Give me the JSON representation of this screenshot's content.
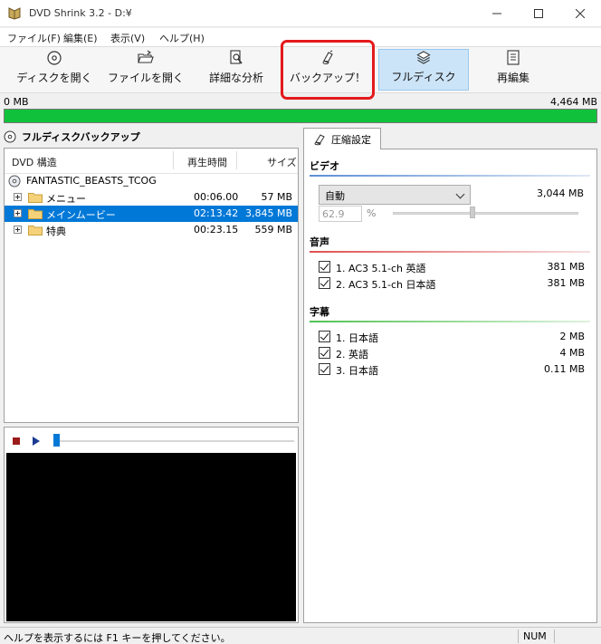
{
  "window": {
    "title": "DVD Shrink 3.2 - D:¥"
  },
  "menu": {
    "items": [
      "ファイル(F)",
      "編集(E)",
      "表示(V)",
      "ヘルプ(H)"
    ]
  },
  "toolbar": {
    "open_disc": "ディスクを開く",
    "open_files": "ファイルを開く",
    "analysis": "詳細な分析",
    "backup": "バックアップ！",
    "full_disc": "フルディスク",
    "reauthor": "再編集"
  },
  "sizebar": {
    "min_label": "0 MB",
    "max_label": "4,464 MB",
    "fill_fraction": 1.0
  },
  "left": {
    "heading": "フルディスクバックアップ",
    "columns": {
      "structure": "DVD 構造",
      "duration": "再生時間",
      "size": "サイズ"
    },
    "disc_name": "FANTASTIC_BEASTS_TCOG",
    "rows": [
      {
        "name": "メニュー",
        "duration": "00:06.00",
        "size": "57 MB"
      },
      {
        "name": "メインムービー",
        "duration": "02:13.42",
        "size": "3,845 MB"
      },
      {
        "name": "特典",
        "duration": "00:23.15",
        "size": "559 MB"
      }
    ]
  },
  "player": {
    "seek_position": 0.0
  },
  "right": {
    "tab_label": "圧縮設定",
    "video": {
      "heading": "ビデオ",
      "mode": "自動",
      "size": "3,044 MB",
      "percent": "62.9",
      "percent_symbol": "%"
    },
    "audio": {
      "heading": "音声",
      "items": [
        {
          "label": "1. AC3 5.1-ch 英語",
          "size": "381 MB"
        },
        {
          "label": "2. AC3 5.1-ch 日本語",
          "size": "381 MB"
        }
      ]
    },
    "subtitles": {
      "heading": "字幕",
      "items": [
        {
          "label": "1. 日本語",
          "size": "2 MB"
        },
        {
          "label": "2. 英語",
          "size": "4 MB"
        },
        {
          "label": "3. 日本語",
          "size": "0.11 MB"
        }
      ]
    }
  },
  "status": {
    "help": "ヘルプを表示するには F1 キーを押してください。",
    "num": "NUM"
  },
  "colors": {
    "progress": "#10c23b",
    "selection": "#0078d7",
    "highlight": "#e3191c",
    "video_line": "#5b8fd6",
    "audio_line": "#e05050",
    "subtitle_line": "#4fc24f"
  }
}
